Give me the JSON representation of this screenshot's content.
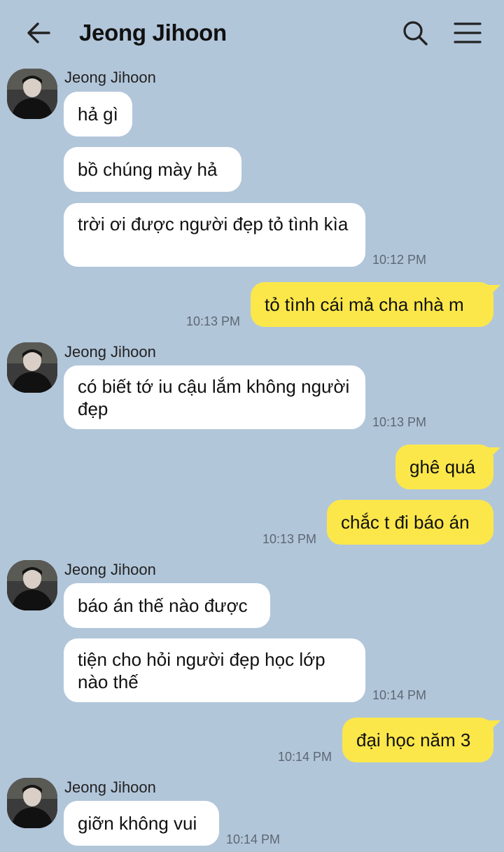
{
  "header": {
    "title": "Jeong Jihoon",
    "back_icon": "back-arrow-icon",
    "search_icon": "search-icon",
    "menu_icon": "menu-icon"
  },
  "colors": {
    "background": "#b2c6da",
    "my_bubble": "#fbe74a",
    "their_bubble": "#ffffff"
  },
  "messages": {
    "g1": {
      "sender": "Jeong Jihoon",
      "m1": "hả gì",
      "m2": "bồ chúng mày hả",
      "m3": "trời ơi được người đẹp tỏ tình kìa",
      "time": "10:12 PM"
    },
    "me1": {
      "m1": "tỏ tình cái mả cha nhà m",
      "time": "10:13 PM"
    },
    "g2": {
      "sender": "Jeong Jihoon",
      "m1": "có biết tớ iu cậu lắm không người đẹp",
      "time": "10:13 PM"
    },
    "me2": {
      "m1": "ghê quá",
      "m2": "chắc t đi báo án",
      "time": "10:13 PM"
    },
    "g3": {
      "sender": "Jeong Jihoon",
      "m1": "báo án thế nào được",
      "m2": "tiện cho hỏi người đẹp học lớp nào thế",
      "time": "10:14 PM"
    },
    "me3": {
      "m1": "đại học năm 3",
      "time": "10:14 PM"
    },
    "g4": {
      "sender": "Jeong Jihoon",
      "m1": "giỡn không vui",
      "time": "10:14 PM"
    }
  }
}
